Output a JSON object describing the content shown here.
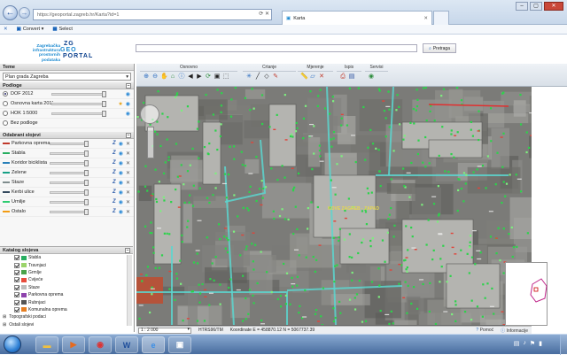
{
  "browser": {
    "url": "https://geoportal.zagreb.hr/Karta?id=1",
    "tab_title": "Karta",
    "favorites_label": "Convert",
    "select_label": "Select"
  },
  "header": {
    "city_text": "Zagrebačka infrastruktura prostornih podataka",
    "logo_zg": "ZG",
    "logo_geo": "GEO",
    "logo_portal": "PORTAL",
    "search_placeholder": "",
    "search_button": "Pretraga"
  },
  "left_panel": {
    "theme_title": "Teme",
    "theme_value": "Plan grada Zagreba",
    "basemaps_title": "Podloge",
    "basemaps": [
      {
        "label": "DOF 2012",
        "selected": true
      },
      {
        "label": "Osnovna karta 2012",
        "selected": false
      },
      {
        "label": "HOK 1:5000",
        "selected": false
      },
      {
        "label": "Bez podloge",
        "selected": false
      }
    ],
    "layers_title": "Odabrani slojevi",
    "layers": [
      {
        "label": "Parkovna oprema",
        "color": "#c0392b"
      },
      {
        "label": "Stabla",
        "color": "#27ae60"
      },
      {
        "label": "Koridor biciklista",
        "color": "#2980b9"
      },
      {
        "label": "Zelene",
        "color": "#16a085"
      },
      {
        "label": "Staze",
        "color": "#7f8c8d"
      },
      {
        "label": "Kerbi ulice",
        "color": "#34495e"
      },
      {
        "label": "Urnilje",
        "color": "#2ecc71"
      },
      {
        "label": "Ostalo",
        "color": "#f39c12"
      }
    ],
    "legend_title": "Katalog slojeva",
    "legend_items": [
      {
        "label": "Stabla",
        "color": "#27ae60"
      },
      {
        "label": "Travnjaci",
        "color": "#9bd46b"
      },
      {
        "label": "Grmlje",
        "color": "#4aa34a"
      },
      {
        "label": "Cvijeće",
        "color": "#e74c3c"
      },
      {
        "label": "Staze",
        "color": "#bdbdbd"
      },
      {
        "label": "Parkovna oprema",
        "color": "#8e44ad"
      },
      {
        "label": "Rubnjaci",
        "color": "#555555"
      },
      {
        "label": "Komunalna oprema",
        "color": "#e67e22"
      }
    ],
    "footer_groups": [
      "Topografski podaci",
      "Ostali slojevi"
    ]
  },
  "toolbar": {
    "groups": [
      {
        "label": "Osnovno"
      },
      {
        "label": "Crtanje"
      },
      {
        "label": "Mjerenje"
      },
      {
        "label": "Ispis"
      },
      {
        "label": "Servisi"
      }
    ]
  },
  "map": {
    "label_street": "NOVE ZAGREB - ZAPAD"
  },
  "status": {
    "scale": "1 : 2 000",
    "projection": "HTRS96/TM",
    "coords": "Koordinate E = 458870.12  N = 5067737.39",
    "help": "Pomoć",
    "info": "Informacije"
  },
  "colors": {
    "accent": "#1d8ad0",
    "logo": "#0a3f8c"
  }
}
